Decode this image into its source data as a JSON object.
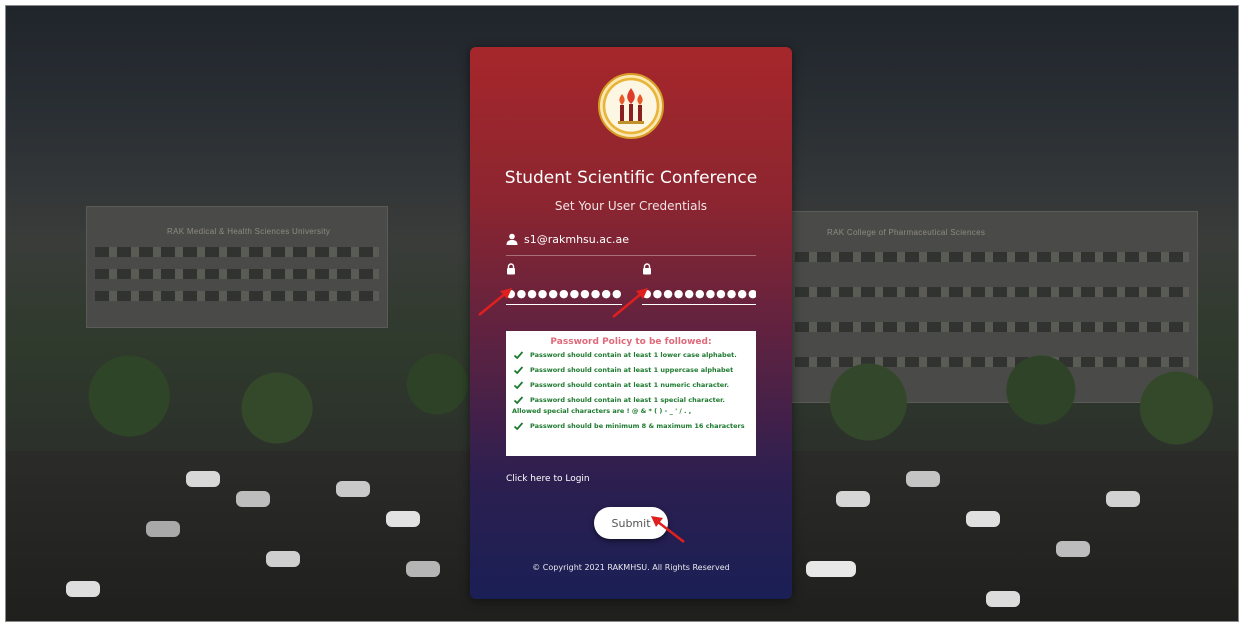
{
  "header": {
    "title": "Student Scientific Conference",
    "subtitle": "Set Your User Credentials"
  },
  "form": {
    "email_value": "s1@rakmhsu.ac.ae",
    "password_value": "●●●●●●●●●●●",
    "confirm_password_value": "●●●●●●●●●●●"
  },
  "policy": {
    "title": "Password Policy to be followed:",
    "rules": [
      "Password should contain at least 1 lower case alphabet.",
      "Password should contain at least 1 uppercase alphabet",
      "Password should contain at least 1 numeric character.",
      "Password should contain at least 1 special character. Allowed special characters are ! @ & * ( ) - _ ' / . ,",
      "Password should be minimum 8 & maximum 16 characters"
    ]
  },
  "links": {
    "login": "Click here to Login"
  },
  "actions": {
    "submit_label": "Submit"
  },
  "footer": {
    "copyright": "© Copyright 2021 RAKMHSU. All Rights Reserved"
  },
  "background": {
    "left_building_label": "RAK Medical & Health Sciences University",
    "right_building_label": "RAK College of Pharmaceutical Sciences"
  },
  "colors": {
    "card_top": "#a6272b",
    "card_bottom": "#1a1f55",
    "policy_title": "#e0697a",
    "policy_rule": "#1d7a2e",
    "annotation_arrow": "#e0201e"
  },
  "icons": [
    "user-icon",
    "lock-icon",
    "check-icon",
    "university-logo"
  ]
}
